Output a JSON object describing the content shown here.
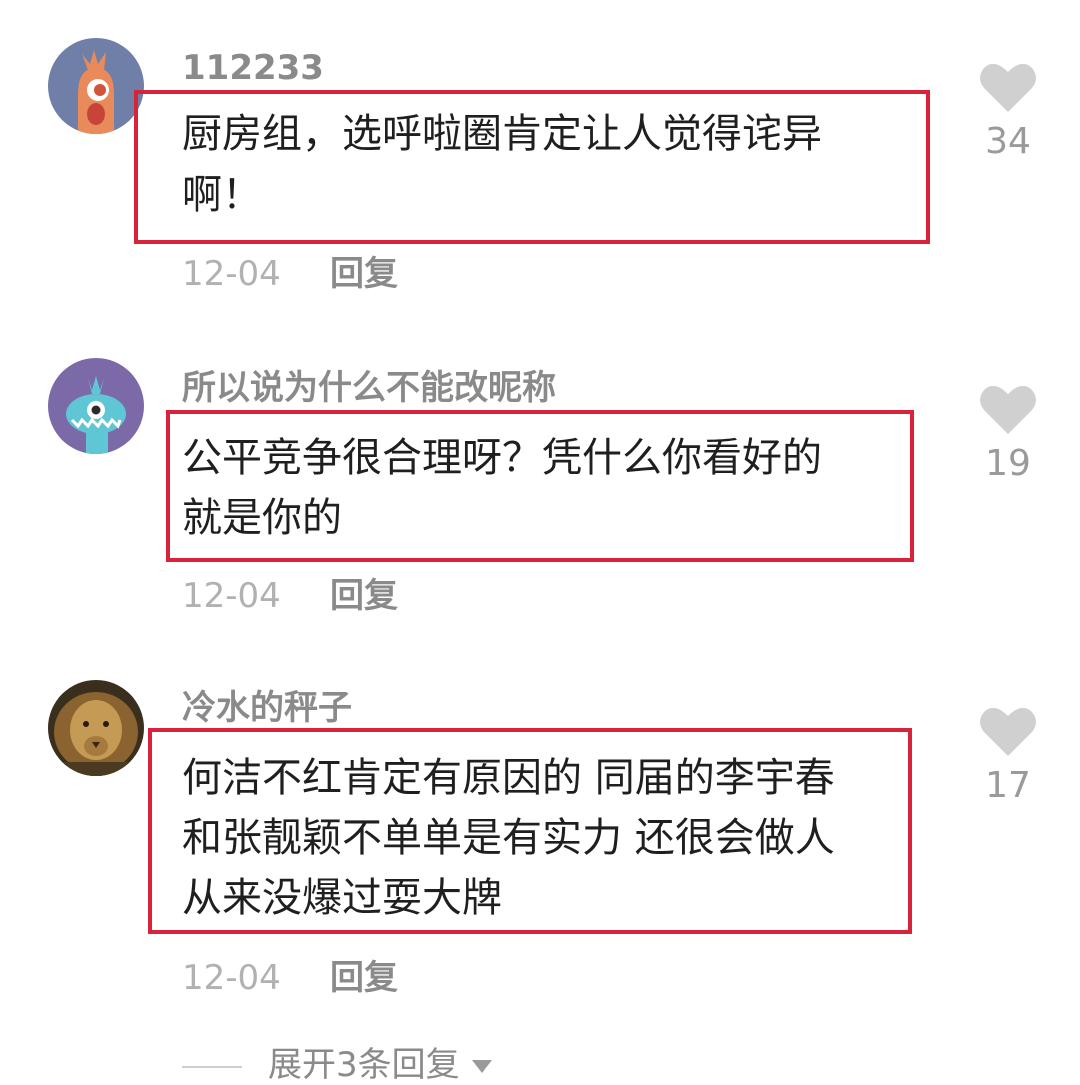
{
  "comments": [
    {
      "username": "112233",
      "lines": [
        "厨房组，选呼啦圈肯定让人觉得诧异",
        "啊！"
      ],
      "date": "12-04",
      "reply_label": "回复",
      "likes": "34",
      "avatar_icon": "orange-monster-avatar-icon"
    },
    {
      "username": "所以说为什么不能改昵称",
      "lines": [
        "公平竞争很合理呀？凭什么你看好的",
        "就是你的"
      ],
      "date": "12-04",
      "reply_label": "回复",
      "likes": "19",
      "avatar_icon": "blue-monster-avatar-icon"
    },
    {
      "username": "冷水的秤子",
      "lines": [
        "何洁不红肯定有原因的 同届的李宇春",
        "和张靓颖不单单是有实力 还很会做人",
        "从来没爆过耍大牌"
      ],
      "date": "12-04",
      "reply_label": "回复",
      "likes": "17",
      "avatar_icon": "lion-photo-avatar-icon"
    }
  ],
  "expand_replies": "展开3条回复",
  "colors": {
    "highlight_border": "#d7243a",
    "username": "#8a8a8a",
    "date": "#b1b1b1",
    "like_heart": "#d0d0d0"
  }
}
